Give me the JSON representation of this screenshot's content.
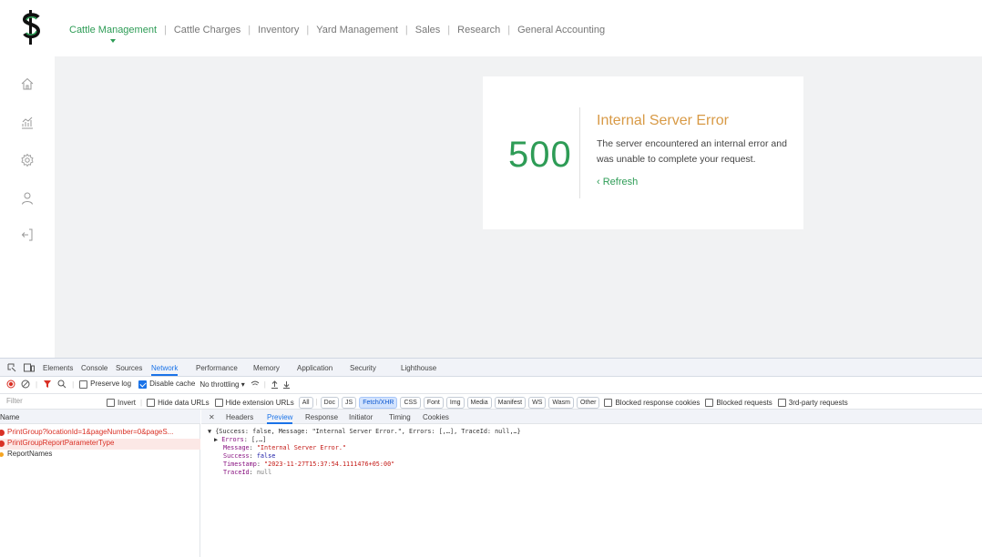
{
  "nav": {
    "items": [
      {
        "label": "Cattle Management",
        "active": true
      },
      {
        "label": "Cattle Charges",
        "active": false
      },
      {
        "label": "Inventory",
        "active": false
      },
      {
        "label": "Yard Management",
        "active": false
      },
      {
        "label": "Sales",
        "active": false
      },
      {
        "label": "Research",
        "active": false
      },
      {
        "label": "General Accounting",
        "active": false
      }
    ]
  },
  "sidebar": {
    "icons": [
      "home-icon",
      "chart-icon",
      "settings-icon",
      "user-icon",
      "logout-icon"
    ]
  },
  "error": {
    "code": "500",
    "title": "Internal Server Error",
    "message": "The server encountered an internal error and was unable to complete your request.",
    "refresh_label": "Refresh",
    "refresh_icon": "chevron-left-icon"
  },
  "devtools": {
    "tabs": [
      "Elements",
      "Console",
      "Sources",
      "Network",
      "Performance",
      "Memory",
      "Application",
      "Security",
      "Lighthouse"
    ],
    "active_tab": "Network",
    "toolbar": {
      "preserve_log": "Preserve log",
      "disable_cache": "Disable cache",
      "throttling": "No throttling"
    },
    "filter": {
      "placeholder": "Filter",
      "invert": "Invert",
      "hide_data_urls": "Hide data URLs",
      "hide_extension_urls": "Hide extension URLs",
      "types": [
        "All",
        "Doc",
        "JS",
        "Fetch/XHR",
        "CSS",
        "Font",
        "Img",
        "Media",
        "Manifest",
        "WS",
        "Wasm",
        "Other"
      ],
      "active_type": "Fetch/XHR",
      "blocked_cookies": "Blocked response cookies",
      "blocked_requests": "Blocked requests",
      "third_party": "3rd-party requests"
    },
    "requests_header": "Name",
    "requests": [
      {
        "name": "PrintGroup?locationId=1&pageNumber=0&pageS...",
        "status": "error"
      },
      {
        "name": "PrintGroupReportParameterType",
        "status": "error"
      },
      {
        "name": "ReportNames",
        "status": "ok"
      }
    ],
    "detail_tabs": [
      "Headers",
      "Preview",
      "Response",
      "Initiator",
      "Timing",
      "Cookies"
    ],
    "active_detail_tab": "Preview",
    "preview": {
      "summary": "{Success: false, Message: \"Internal Server Error.\", Errors: [,…], TraceId: null,…}",
      "errors_key": "Errors",
      "errors_val": "[,…]",
      "message_key": "Message",
      "message_val": "\"Internal Server Error.\"",
      "success_key": "Success",
      "success_val": "false",
      "timestamp_key": "Timestamp",
      "timestamp_val": "\"2023-11-27T15:37:54.1111476+05:00\"",
      "traceid_key": "TraceId",
      "traceid_val": "null"
    }
  }
}
